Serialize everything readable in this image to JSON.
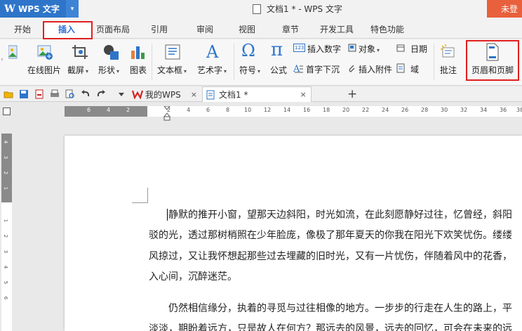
{
  "app": {
    "title": "WPS 文字",
    "logo_letter": "W",
    "dropdown_glyph": "▾"
  },
  "window": {
    "doc_title": "文档1 * - WPS 文字",
    "login_label": "未登"
  },
  "menu": {
    "tabs": [
      "开始",
      "插入",
      "页面布局",
      "引用",
      "审阅",
      "视图",
      "章节",
      "开发工具",
      "特色功能"
    ],
    "active_tab": "插入"
  },
  "ribbon": {
    "online_image": "在线图片",
    "screenshot": "截屏",
    "shapes": "形状",
    "chart": "图表",
    "textbox": "文本框",
    "wordart": "艺术字",
    "symbol": "符号",
    "formula": "公式",
    "insert_number": "插入数字",
    "object": "对象",
    "date": "日期",
    "dropcap": "首字下沉",
    "attachment": "插入附件",
    "field": "域",
    "comment": "批注",
    "header_footer": "页眉和页脚",
    "dropdown_glyph": "▾",
    "num_icon_text": "123",
    "omega": "Ω",
    "pi": "π"
  },
  "quickbar": {
    "tabs": [
      {
        "label": "我的WPS",
        "close": "×"
      },
      {
        "label": "文档1 *",
        "close": "×"
      }
    ],
    "add_glyph": "+"
  },
  "ruler": {
    "h_dark": [
      "6",
      "4",
      "2"
    ],
    "h_light": [
      "2",
      "4",
      "6",
      "8",
      "10",
      "12",
      "14",
      "16",
      "18",
      "20",
      "22",
      "24",
      "26",
      "28",
      "30",
      "32",
      "34",
      "36",
      "38"
    ],
    "v_dark": [
      "4",
      "3",
      "2",
      "1"
    ],
    "v_light": [
      "1",
      "2",
      "3",
      "4",
      "5",
      "6"
    ]
  },
  "document": {
    "lines": [
      "静默的推开小窗，望那天边斜阳，时光如流，在此刻愿静好过往，忆曾经，斜阳",
      "驳的光，透过那树梢照在少年脸庞，像极了那年夏天的你我在阳光下欢笑忧伤。缕缕",
      "风掠过，又让我怀想起那些过去埋藏的旧时光，又有一片忧伤，伴随着风中的花香，",
      "入心间，沉醉迷茫。",
      "仍然相信缘分，执着的寻觅与过往相像的地方。一步步的行走在人生的路上，平",
      "淡淡，期盼着远方，只是故人在何方？那远去的风景，远去的回忆，可会在未来的远"
    ]
  },
  "colors": {
    "accent": "#2e75c9",
    "highlight": "#e01f1f",
    "login_bg": "#e8603c"
  }
}
